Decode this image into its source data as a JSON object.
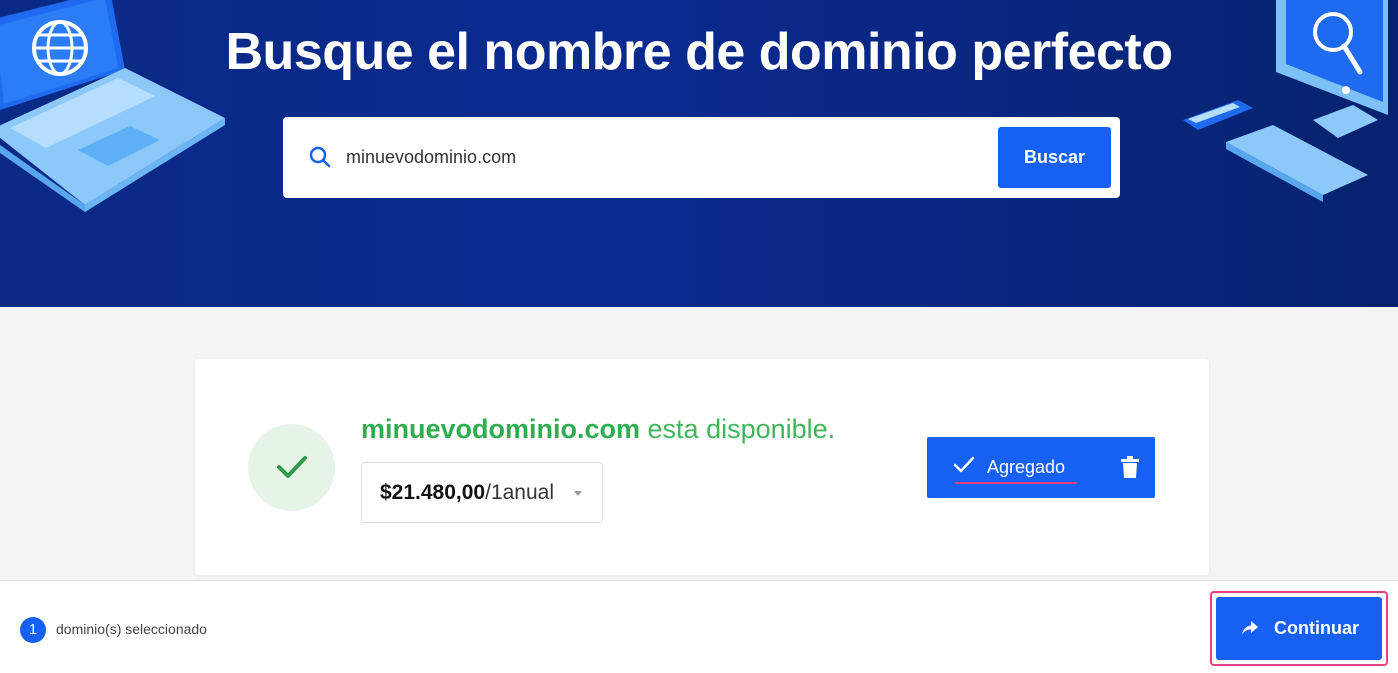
{
  "hero": {
    "title": "Busque el nombre de dominio perfecto"
  },
  "search": {
    "value": "minuevodominio.com",
    "button_label": "Buscar",
    "icon": "search-icon"
  },
  "result": {
    "domain": "minuevodominio.com",
    "status_text": " esta disponible.",
    "price_amount": "$21.480,00",
    "price_period": "/1anual",
    "added_label": "Agregado"
  },
  "footer": {
    "selected_count": "1",
    "selected_label": "dominio(s) seleccionado",
    "continue_label": "Continuar"
  },
  "colors": {
    "hero_bg": "#0b2a86",
    "accent": "#1660f4",
    "success": "#2fae4f",
    "highlight": "#e5417e"
  }
}
